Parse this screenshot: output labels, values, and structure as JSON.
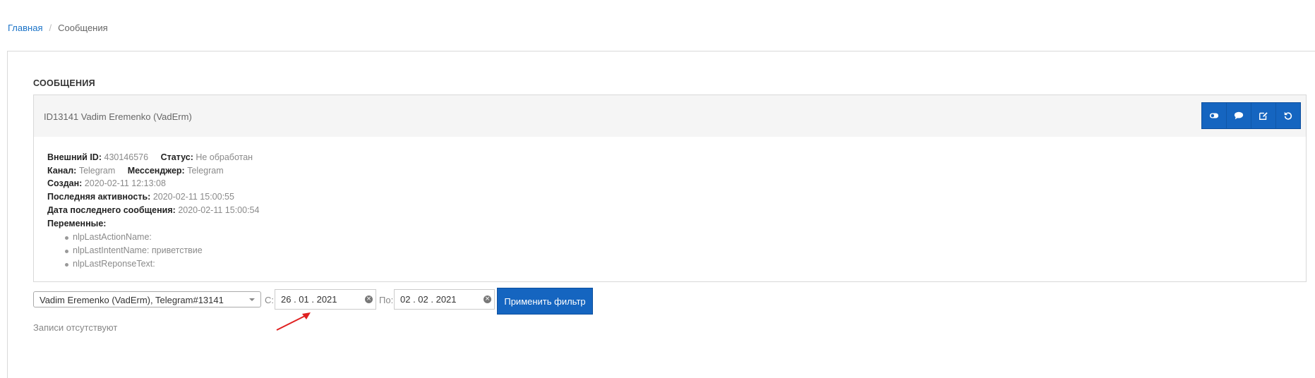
{
  "breadcrumb": {
    "home": "Главная",
    "separator": "/",
    "current": "Сообщения"
  },
  "section_title": "СООБЩЕНИЯ",
  "card": {
    "title": "ID13141 Vadim Eremenko (VadErm)",
    "actions": [
      {
        "name": "toggle-icon"
      },
      {
        "name": "comment-icon"
      },
      {
        "name": "edit-icon"
      },
      {
        "name": "reset-icon"
      }
    ],
    "info": {
      "external_id_label": "Внешний ID:",
      "external_id": "430146576",
      "status_label": "Статус:",
      "status": "Не обработан",
      "channel_label": "Канал:",
      "channel": "Telegram",
      "messenger_label": "Мессенджер:",
      "messenger": "Telegram",
      "created_label": "Создан:",
      "created": "2020-02-11 12:13:08",
      "last_activity_label": "Последняя активность:",
      "last_activity": "2020-02-11 15:00:55",
      "last_message_label": "Дата последнего сообщения:",
      "last_message": "2020-02-11 15:00:54",
      "variables_label": "Переменные:",
      "variables": [
        "nlpLastActionName:",
        "nlpLastIntentName: приветствие",
        "nlpLastReponseText:"
      ]
    }
  },
  "filter": {
    "selected_chat": "Vadim Eremenko (VadErm), Telegram#13141",
    "from_label": "С:",
    "from_date": "26 . 01 . 2021",
    "to_label": "По:",
    "to_date": "02 . 02 . 2021",
    "apply_label": "Применить фильтр"
  },
  "empty_text": "Записи отсутствуют",
  "colors": {
    "primary": "#1565c0",
    "link": "#1a73c8",
    "annotation_arrow": "#e02020"
  }
}
